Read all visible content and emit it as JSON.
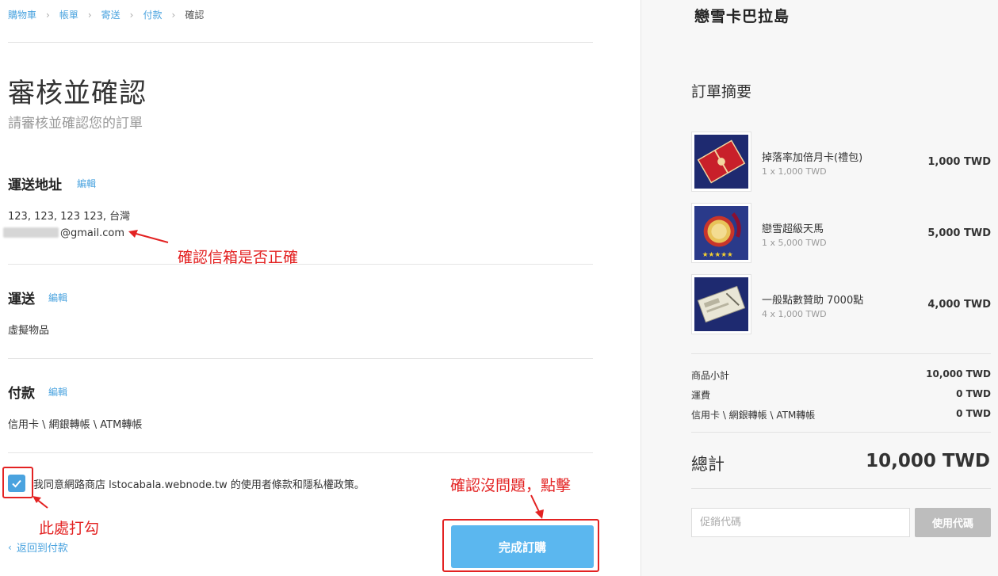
{
  "breadcrumb": {
    "items": [
      "購物車",
      "帳單",
      "寄送",
      "付款"
    ],
    "current": "確認"
  },
  "page": {
    "title": "審核並確認",
    "subtitle": "請審核並確認您的訂單"
  },
  "shipping_address": {
    "title": "運送地址",
    "edit": "編輯",
    "address": "123, 123, 123 123, 台灣",
    "email_suffix": "@gmail.com"
  },
  "shipping": {
    "title": "運送",
    "edit": "編輯",
    "method": "虛擬物品"
  },
  "payment": {
    "title": "付款",
    "edit": "編輯",
    "method": "信用卡 \\ 網銀轉帳 \\ ATM轉帳"
  },
  "terms": {
    "checked": true,
    "text": "我同意網路商店 lstocabala.webnode.tw 的使用者條款和隱私權政策。"
  },
  "back_link": "返回到付款",
  "submit_label": "完成訂購",
  "annotations": {
    "email": "確認信箱是否正確",
    "checkbox": "此處打勾",
    "submit": "確認沒問題，點擊"
  },
  "shop_name": "戀雪卡巴拉島",
  "summary": {
    "title": "訂單摘要",
    "items": [
      {
        "name": "掉落率加倍月卡(禮包)",
        "qty": "1 x 1,000 TWD",
        "price": "1,000 TWD",
        "icon": "red-gift-card-icon"
      },
      {
        "name": "戀雪超級天馬",
        "qty": "1 x 5,000 TWD",
        "price": "5,000 TWD",
        "icon": "gold-medal-icon"
      },
      {
        "name": "一般點數贊助 7000點",
        "qty": "4 x 1,000 TWD",
        "price": "4,000 TWD",
        "icon": "ticket-icon"
      }
    ],
    "subtotal_label": "商品小計",
    "subtotal": "10,000 TWD",
    "shipping_label": "運費",
    "shipping": "0 TWD",
    "payment_label": "信用卡 \\ 網銀轉帳 \\ ATM轉帳",
    "payment_fee": "0 TWD",
    "total_label": "總計",
    "total": "10,000 TWD"
  },
  "promo": {
    "placeholder": "促銷代碼",
    "button": "使用代碼"
  },
  "colors": {
    "link": "#4aa3df",
    "button": "#5bb7ef",
    "annotation": "#e32222"
  }
}
